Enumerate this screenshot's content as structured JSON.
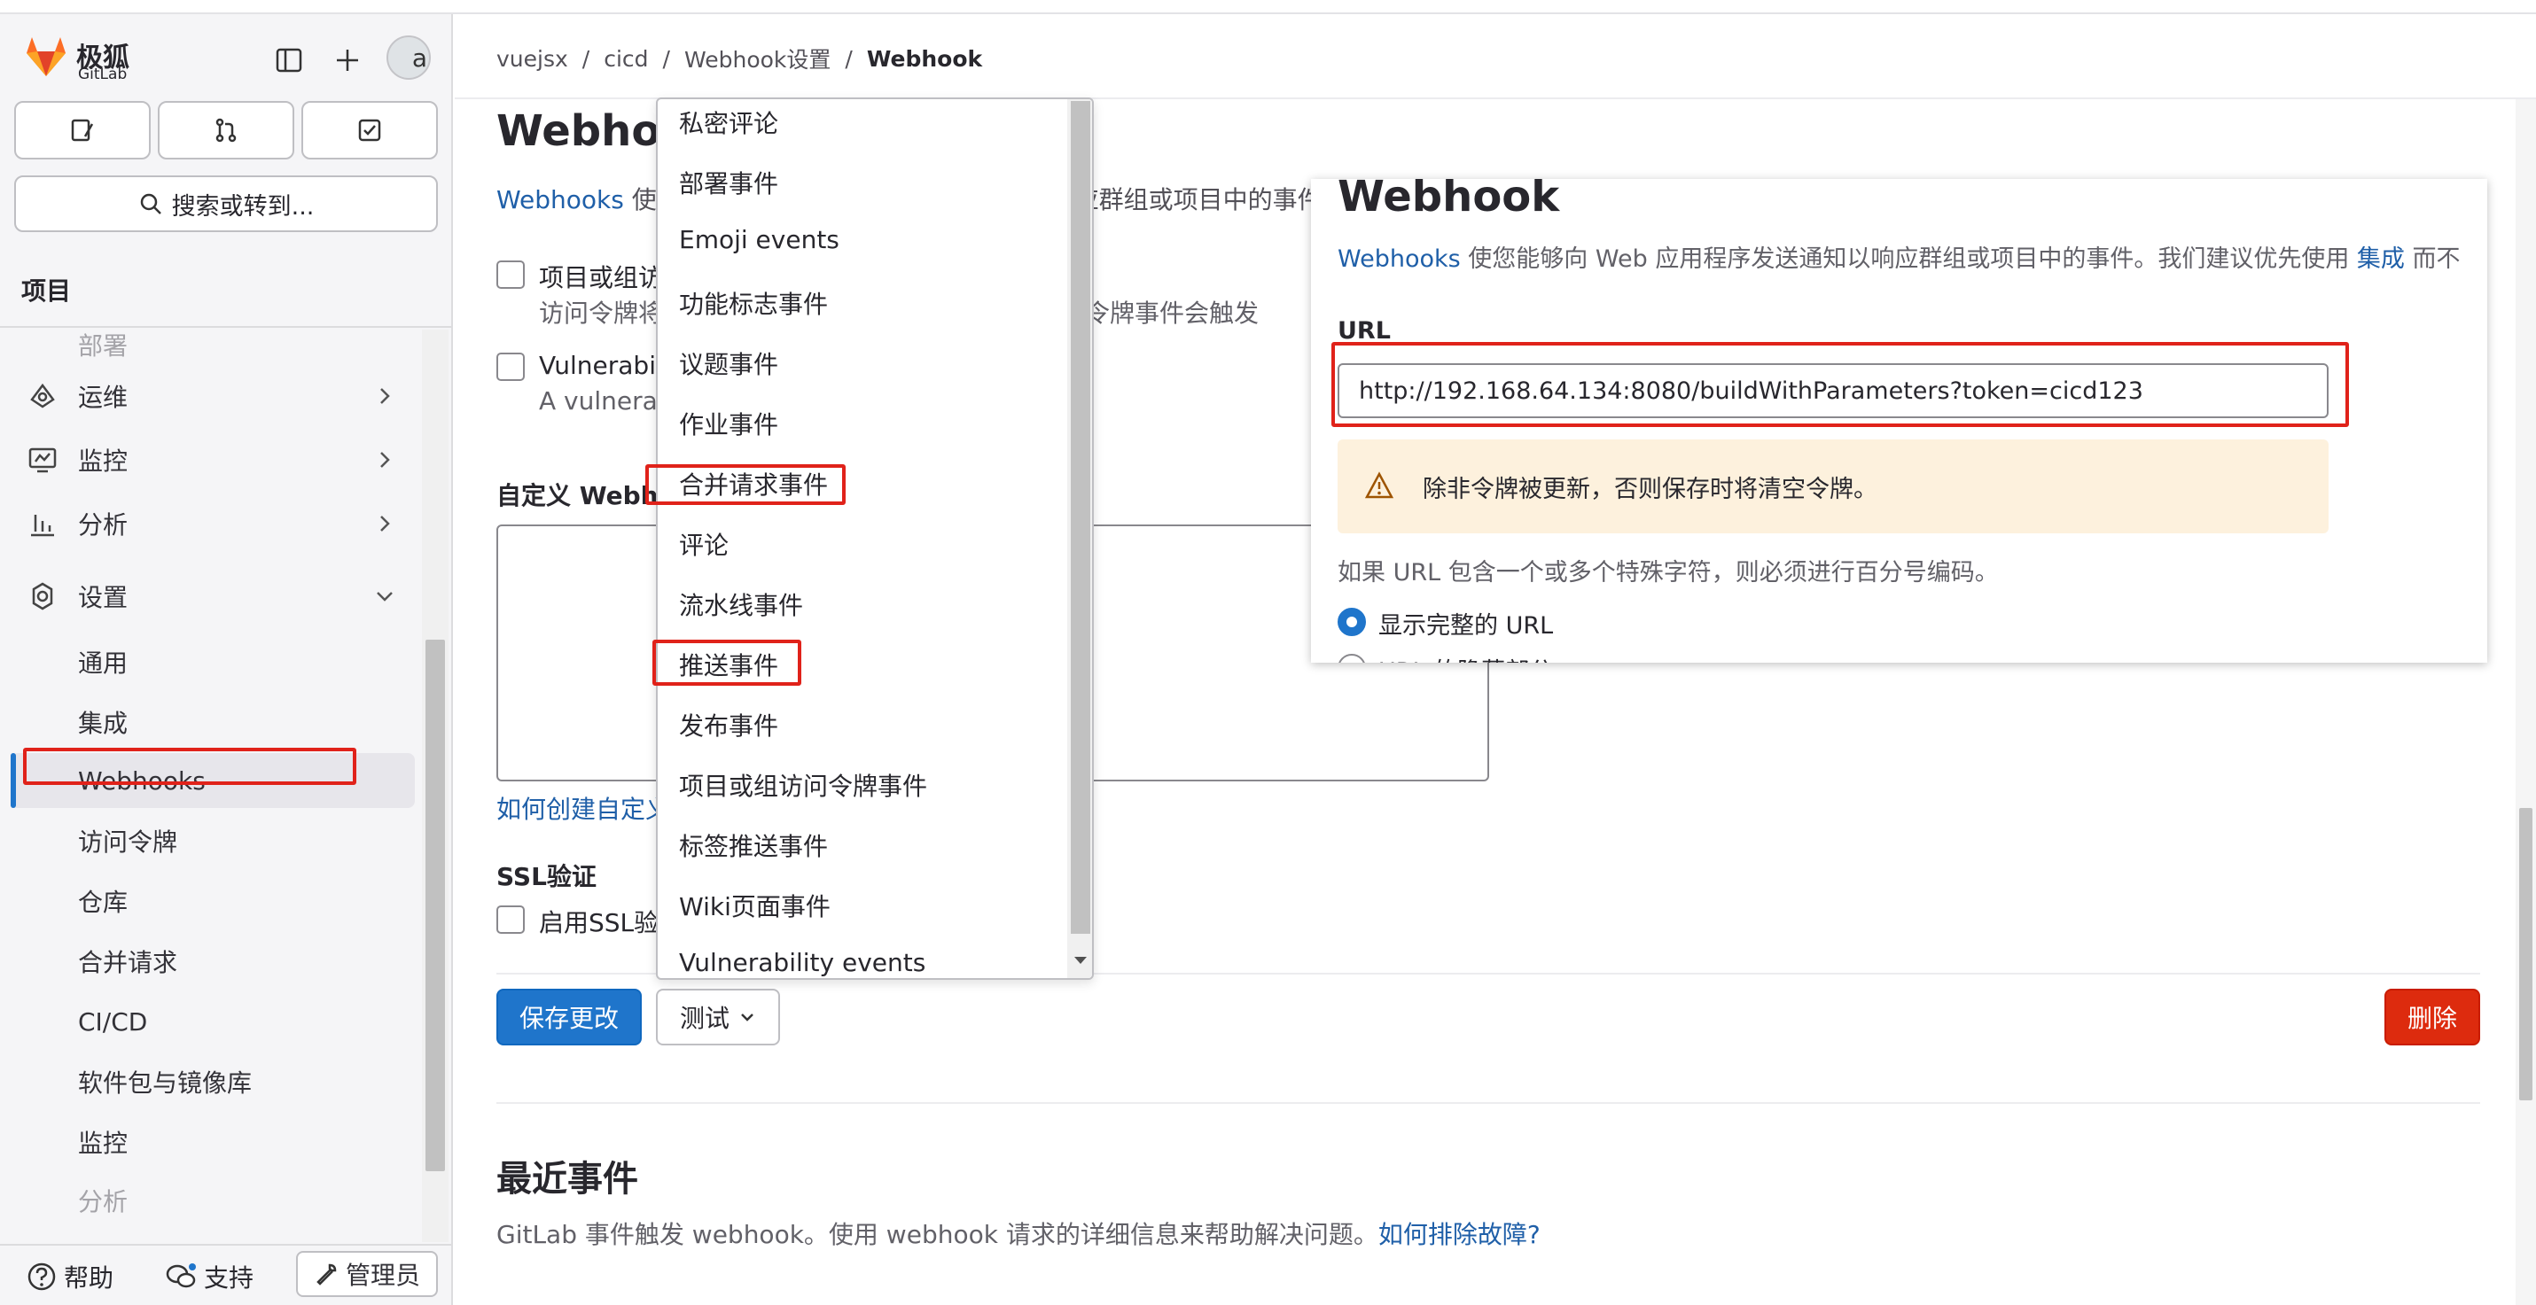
{
  "brand": {
    "name": "极狐",
    "sub": "GitLab"
  },
  "sidebar": {
    "search_label": "搜索或转到...",
    "section_title": "项目",
    "partial_item": "部署",
    "items": [
      {
        "label": "运维",
        "icon": "operate-icon"
      },
      {
        "label": "监控",
        "icon": "monitor-icon"
      },
      {
        "label": "分析",
        "icon": "analytics-icon"
      },
      {
        "label": "设置",
        "icon": "settings-icon"
      }
    ],
    "sub_items": [
      "通用",
      "集成",
      "Webhooks",
      "访问令牌",
      "仓库",
      "合并请求",
      "CI/CD",
      "软件包与镜像库",
      "监控",
      "分析"
    ],
    "bottom": {
      "help": "帮助",
      "support": "支持",
      "admin": "管理员"
    }
  },
  "breadcrumbs": [
    "vuejsx",
    "cicd",
    "Webhook设置",
    "Webhook"
  ],
  "main": {
    "title": "Webhook",
    "desc_link": "Webhooks",
    "desc_rest": " 使您能够向 Web 应用程序发送通知以响应群组或项目中的事件。",
    "option1_label": "项目或组访问令牌事件",
    "option1_help": "访问令牌将在一天、七天、三十天后过期时，访问令牌事件会触发",
    "option2_label": "Vulnerability events",
    "option2_help": "A vulnerability is created or updated.",
    "custom_label": "自定义 Webhook 模板",
    "custom_link": "如何创建自定义 Webhook 模板？",
    "ssl_title": "SSL验证",
    "ssl_label": "启用SSL验证",
    "save_label": "保存更改",
    "test_label": "测试",
    "delete_label": "删除",
    "recent_title": "最近事件",
    "recent_desc": "GitLab 事件触发 webhook。使用 webhook 请求的详细信息来帮助解决问题。",
    "recent_link": "如何排除故障?"
  },
  "dropdown": {
    "items": [
      "私密评论",
      "部署事件",
      "Emoji events",
      "功能标志事件",
      "议题事件",
      "作业事件",
      "合并请求事件",
      "评论",
      "流水线事件",
      "推送事件",
      "发布事件",
      "项目或组访问令牌事件",
      "标签推送事件",
      "Wiki页面事件",
      "Vulnerability events"
    ]
  },
  "panel": {
    "title": "Webhook",
    "desc_link": "Webhooks",
    "desc_rest": " 使您能够向 Web 应用程序发送通知以响应群组或项目中的事件。我们建议优先使用 ",
    "desc_link2": "集成",
    "desc_tail": " 而不",
    "url_label": "URL",
    "url_value": "http://192.168.64.134:8080/buildWithParameters?token=cicd123",
    "warning": "除非令牌被更新，否则保存时将清空令牌。",
    "note": "如果 URL 包含一个或多个特殊字符，则必须进行百分号编码。",
    "radio1": "显示完整的 URL",
    "radio2": "URL 的隐藏部分"
  },
  "colors": {
    "accent": "#1f75cb",
    "danger": "#dd2b0e",
    "highlight": "#e0221a",
    "warning_bg": "#fdf1dd"
  }
}
